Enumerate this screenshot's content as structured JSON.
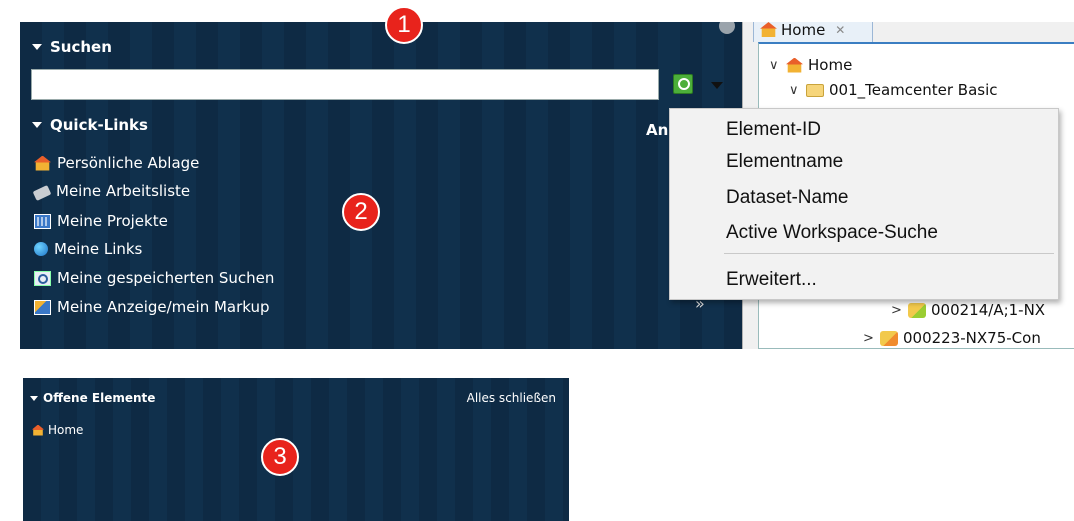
{
  "badges": [
    "1",
    "2",
    "3"
  ],
  "search": {
    "header": "Suchen",
    "input_value": "",
    "placeholder": ""
  },
  "quick_links": {
    "header": "Quick-Links",
    "side_label": "An",
    "more_glyph": "»",
    "items": [
      {
        "label": "Persönliche Ablage",
        "icon": "home-icon"
      },
      {
        "label": "Meine Arbeitsliste",
        "icon": "worklist-icon"
      },
      {
        "label": "Meine Projekte",
        "icon": "project-icon"
      },
      {
        "label": "Meine Links",
        "icon": "links-icon"
      },
      {
        "label": "Meine gespeicherten Suchen",
        "icon": "saved-search-icon"
      },
      {
        "label": "Meine Anzeige/mein Markup",
        "icon": "markup-icon"
      }
    ]
  },
  "context_menu": {
    "items": [
      "Element-ID",
      "Elementname",
      "Dataset-Name",
      "Active Workspace-Suche"
    ],
    "advanced": "Erweitert..."
  },
  "tree": {
    "tab_label": "Home",
    "tab_close": "✕",
    "rows": [
      {
        "label": "Home",
        "chevron": "∨"
      },
      {
        "label": "001_Teamcenter Basic",
        "chevron": "∨"
      },
      {
        "label": "000214/A;1-NX",
        "chevron": ">"
      },
      {
        "label": "000223-NX75-Con",
        "chevron": ">"
      }
    ]
  },
  "open_elements": {
    "header": "Offene Elemente",
    "close_all": "Alles schließen",
    "items": [
      "Home"
    ]
  },
  "colors": {
    "panel_bg": "#0e2a44",
    "badge": "#e8231c",
    "menu_bg": "#f2f2f2"
  }
}
